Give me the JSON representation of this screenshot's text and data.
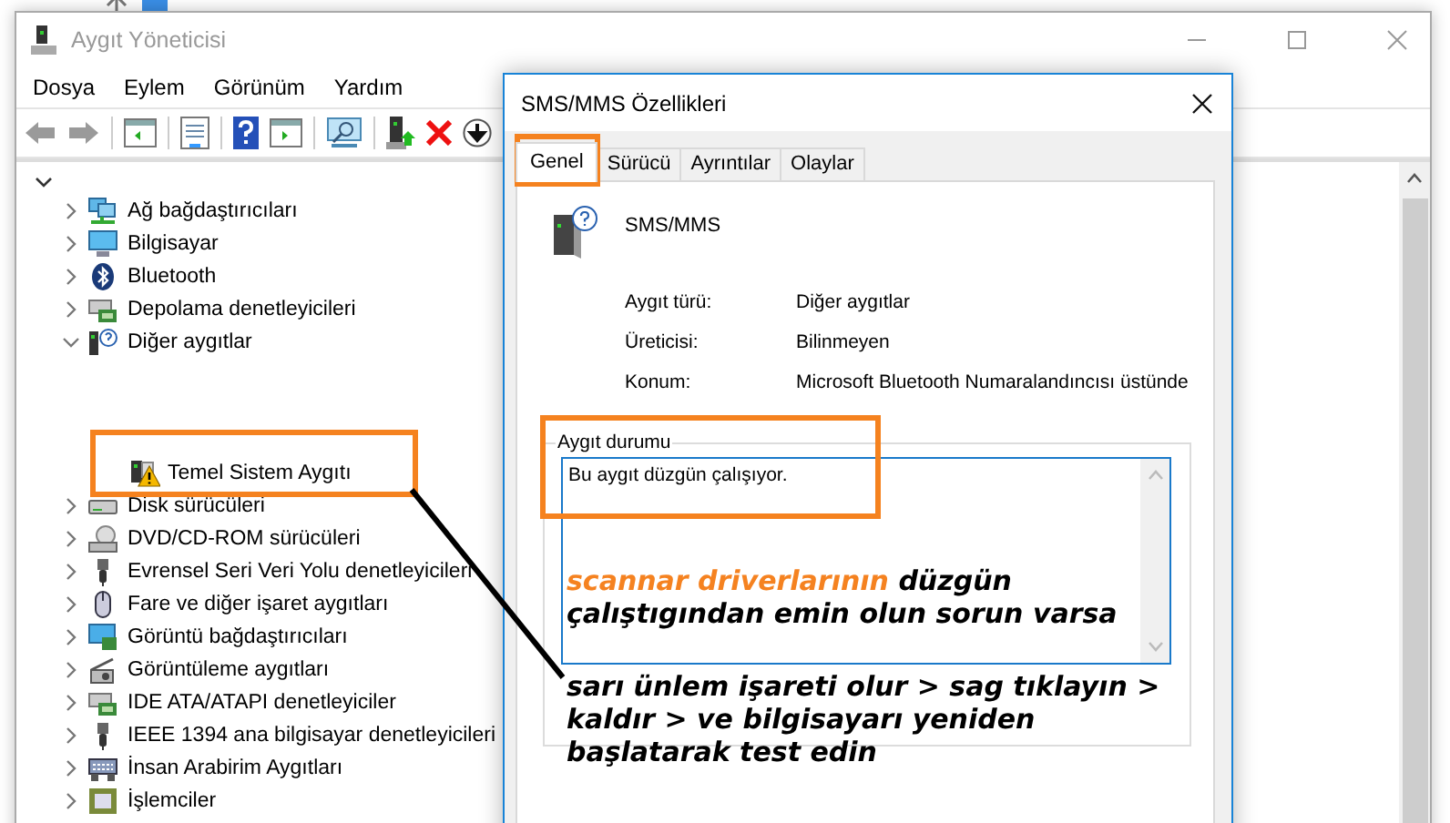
{
  "window": {
    "title": "Aygıt Yöneticisi"
  },
  "menu": [
    "Dosya",
    "Eylem",
    "Görünüm",
    "Yardım"
  ],
  "tree": {
    "expanded": true,
    "items": [
      {
        "label": "Ağ bağdaştırıcıları",
        "expanded": false
      },
      {
        "label": "Bilgisayar",
        "expanded": false
      },
      {
        "label": "Bluetooth",
        "expanded": false
      },
      {
        "label": "Depolama denetleyicileri",
        "expanded": false
      },
      {
        "label": "Diğer aygıtlar",
        "expanded": true,
        "children": [
          {
            "label": "Temel Sistem Aygıtı",
            "warning": true
          }
        ]
      },
      {
        "label": "Disk sürücüleri",
        "expanded": false
      },
      {
        "label": "DVD/CD-ROM sürücüleri",
        "expanded": false
      },
      {
        "label": "Evrensel Seri Veri Yolu denetleyicileri",
        "expanded": false
      },
      {
        "label": "Fare ve diğer işaret aygıtları",
        "expanded": false
      },
      {
        "label": "Görüntü bağdaştırıcıları",
        "expanded": false
      },
      {
        "label": "Görüntüleme aygıtları",
        "expanded": false
      },
      {
        "label": "IDE ATA/ATAPI denetleyiciler",
        "expanded": false
      },
      {
        "label": "IEEE 1394 ana bilgisayar denetleyicileri",
        "expanded": false
      },
      {
        "label": "İnsan Arabirim Aygıtları",
        "expanded": false
      },
      {
        "label": "İşlemciler",
        "expanded": false
      }
    ]
  },
  "dialog": {
    "title": "SMS/MMS Özellikleri",
    "tabs": [
      {
        "label": "Genel",
        "selected": true
      },
      {
        "label": "Sürücü",
        "selected": false
      },
      {
        "label": "Ayrıntılar",
        "selected": false
      },
      {
        "label": "Olaylar",
        "selected": false
      }
    ],
    "device_name": "SMS/MMS",
    "properties": [
      {
        "label": "Aygıt türü:",
        "value": "Diğer aygıtlar"
      },
      {
        "label": "Üreticisi:",
        "value": "Bilinmeyen"
      },
      {
        "label": "Konum:",
        "value": "Microsoft Bluetooth Numaralandıncısı üstünde"
      }
    ],
    "status": {
      "legend": "Aygıt durumu",
      "text": "Bu aygıt düzgün çalışıyor."
    }
  },
  "annotation": {
    "highlight": "scannar driverlarının",
    "first_part": "düzgün çalıştıgından emin olun sorun varsa",
    "second_part": "sarı ünlem işareti olur > sag tıklayın > kaldır > ve bilgisayarı yeniden başlatarak test edin"
  }
}
